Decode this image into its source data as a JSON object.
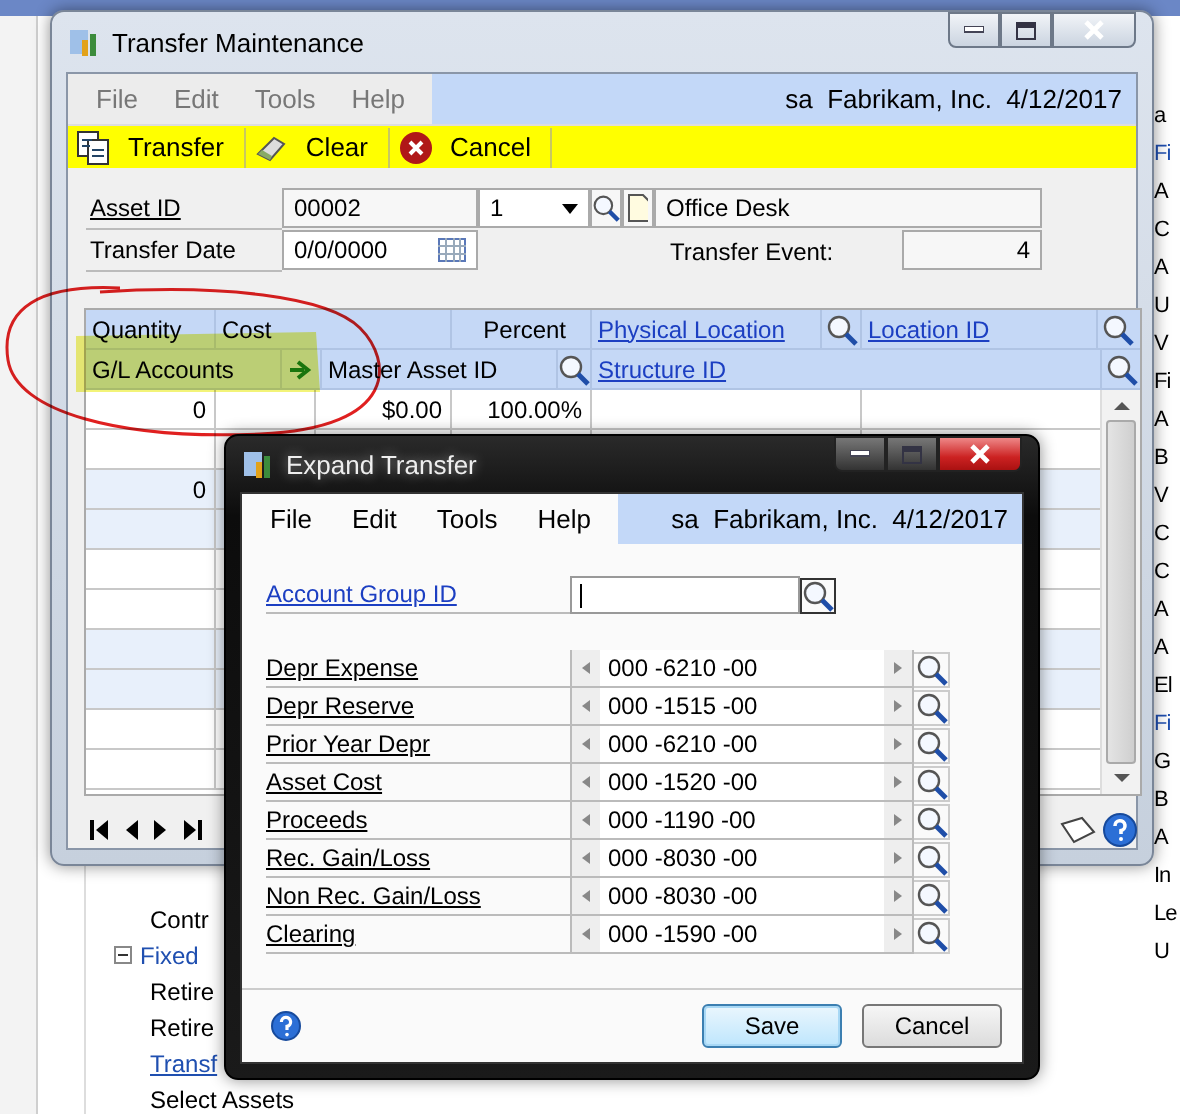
{
  "background": {
    "tree_items": [
      {
        "label": "Contr",
        "kind": "text"
      },
      {
        "label": "Fixed",
        "kind": "group",
        "expanded": true
      },
      {
        "label": "Retire",
        "kind": "text"
      },
      {
        "label": "Retire",
        "kind": "text"
      },
      {
        "label": "Transf",
        "kind": "link"
      },
      {
        "label": "Select Assets",
        "kind": "text"
      }
    ],
    "right_fragments": [
      {
        "label": "a",
        "kind": "text"
      },
      {
        "label": "Fi",
        "kind": "link"
      },
      {
        "label": "A",
        "kind": "text"
      },
      {
        "label": "C",
        "kind": "text"
      },
      {
        "label": "A",
        "kind": "text"
      },
      {
        "label": "U",
        "kind": "text"
      },
      {
        "label": "V",
        "kind": "text"
      },
      {
        "label": "Fi",
        "kind": "text"
      },
      {
        "label": "A",
        "kind": "text"
      },
      {
        "label": "B",
        "kind": "text"
      },
      {
        "label": "V",
        "kind": "text"
      },
      {
        "label": "C",
        "kind": "text"
      },
      {
        "label": "C",
        "kind": "text"
      },
      {
        "label": "A",
        "kind": "text"
      },
      {
        "label": "A",
        "kind": "text"
      },
      {
        "label": "El",
        "kind": "text"
      },
      {
        "label": "Fi",
        "kind": "link"
      },
      {
        "label": "G",
        "kind": "text"
      },
      {
        "label": "B",
        "kind": "text"
      },
      {
        "label": "A",
        "kind": "text"
      },
      {
        "label": "In",
        "kind": "text"
      },
      {
        "label": "Le",
        "kind": "text"
      },
      {
        "label": "U",
        "kind": "text"
      }
    ]
  },
  "main_window": {
    "title": "Transfer Maintenance",
    "active": false,
    "menu": [
      "File",
      "Edit",
      "Tools",
      "Help"
    ],
    "user_info": "sa  Fabrikam, Inc.  4/12/2017",
    "toolbar": [
      {
        "label": "Transfer",
        "kind": "transfer"
      },
      {
        "label": "Clear",
        "kind": "clear"
      },
      {
        "label": "Cancel",
        "kind": "cancel"
      }
    ],
    "asset_id": {
      "label": "Asset ID",
      "value": "00002",
      "suffix": "1",
      "description": "Office Desk"
    },
    "transfer_date": {
      "label": "Transfer Date",
      "value": "0/0/0000"
    },
    "transfer_event": {
      "label": "Transfer Event:",
      "value": "4"
    },
    "grid": {
      "header_1": {
        "quantity": "Quantity",
        "cost": "Cost",
        "percent": "Percent",
        "physical_location": "Physical Location",
        "location_id": "Location ID"
      },
      "header_2": {
        "gl_accounts": "G/L Accounts",
        "master_asset_id": "Master Asset ID",
        "structure_id": "Structure ID"
      },
      "records": [
        {
          "quantity": "0",
          "cost": "$0.00",
          "percent": "100.00%"
        },
        {
          "quantity": "0"
        }
      ]
    }
  },
  "dialog": {
    "title": "Expand Transfer",
    "active": true,
    "menu": [
      "File",
      "Edit",
      "Tools",
      "Help"
    ],
    "user_info": "sa  Fabrikam, Inc.  4/12/2017",
    "account_group": {
      "label": "Account Group ID",
      "focused": true
    },
    "accounts": [
      {
        "label": "Depr Expense",
        "value": "000 -6210 -00"
      },
      {
        "label": "Depr Reserve",
        "value": "000 -1515 -00"
      },
      {
        "label": "Prior Year Depr",
        "value": "000 -6210 -00"
      },
      {
        "label": "Asset Cost",
        "value": "000 -1520 -00"
      },
      {
        "label": "Proceeds",
        "value": "000 -1190 -00"
      },
      {
        "label": "Rec. Gain/Loss",
        "value": "000 -8030 -00"
      },
      {
        "label": "Non Rec. Gain/Loss",
        "value": "000 -8030 -00"
      },
      {
        "label": "Clearing",
        "value": "000 -1590 -00"
      }
    ],
    "buttons": [
      {
        "label": "Save",
        "selected": true
      },
      {
        "label": "Cancel",
        "selected": false
      }
    ]
  }
}
